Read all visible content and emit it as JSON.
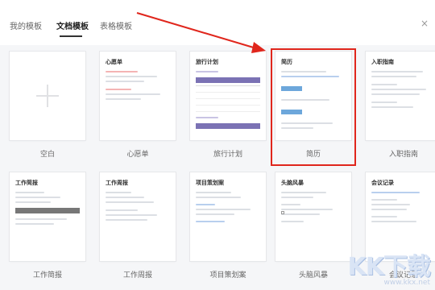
{
  "tabs": [
    {
      "label": "我的模板"
    },
    {
      "label": "文档模板"
    },
    {
      "label": "表格模板"
    }
  ],
  "close_label": "×",
  "row1": [
    {
      "label": "空白",
      "title": ""
    },
    {
      "label": "心愿单",
      "title": "心愿单"
    },
    {
      "label": "旅行计划",
      "title": "旅行计划"
    },
    {
      "label": "简历",
      "title": "简历"
    },
    {
      "label": "入职指南",
      "title": "入职指南"
    }
  ],
  "row2": [
    {
      "label": "工作简报",
      "title": "工作简报"
    },
    {
      "label": "工作周报",
      "title": "工作周报"
    },
    {
      "label": "项目策划案",
      "title": "项目策划案"
    },
    {
      "label": "头脑风暴",
      "title": "头脑风暴"
    },
    {
      "label": "会议记录",
      "title": "会议记录"
    }
  ],
  "colors": {
    "highlight": "#e0261c",
    "arrow": "#e0261c",
    "accent_purple": "#7b72b4",
    "accent_blue": "#6da7db"
  },
  "watermark": {
    "logo": "KK下载",
    "url": "www.kkx.net"
  }
}
